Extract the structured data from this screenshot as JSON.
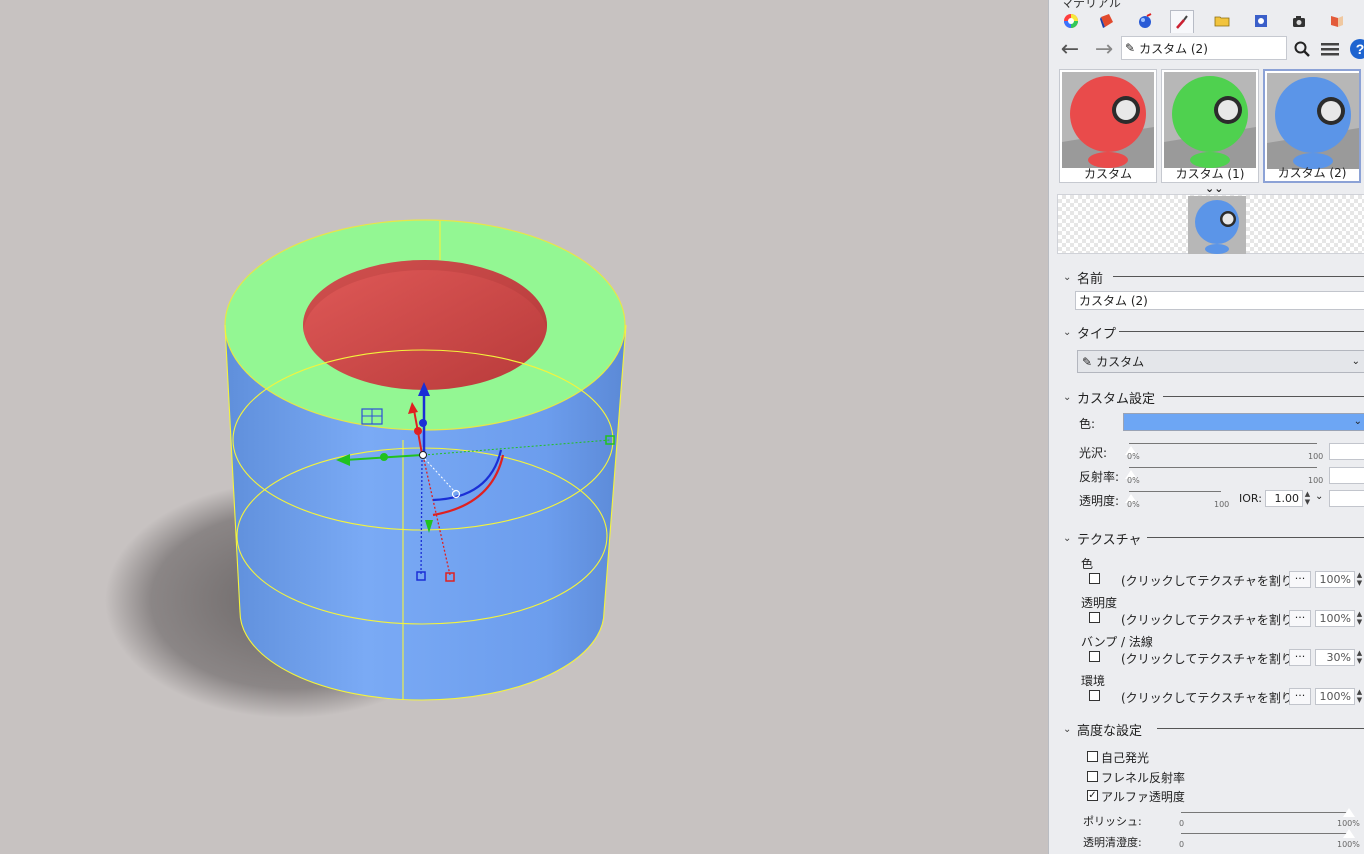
{
  "panel": {
    "title": "マテリアル",
    "tabs": [
      "color-wheel-icon",
      "paint-bucket-icon",
      "sphere-icon",
      "eyedropper-icon",
      "folder-icon",
      "image-icon",
      "camera-icon",
      "material-book-icon"
    ],
    "search": {
      "value": "カスタム (2)"
    },
    "thumbnails": [
      {
        "label": "カスタム",
        "color": "#e94b4b"
      },
      {
        "label": "カスタム (1)",
        "color": "#4fd14f"
      },
      {
        "label": "カスタム (2)",
        "color": "#5b95e8"
      }
    ],
    "expand_glyph": "⌄⌄"
  },
  "sections": {
    "name": {
      "title": "名前",
      "value": "カスタム (2)"
    },
    "type": {
      "title": "タイプ",
      "value": "カスタム"
    },
    "custom": {
      "title": "カスタム設定",
      "color_label": "色:",
      "color_value": "#6da6f4",
      "gloss_label": "光沢:",
      "reflect_label": "反射率:",
      "transparency_label": "透明度:",
      "ior_label": "IOR:",
      "ior_value": "1.00",
      "tick_min": "0%",
      "tick_max": "100"
    },
    "texture": {
      "title": "テクスチャ",
      "rows": [
        {
          "label": "色",
          "text": "(クリックしてテクスチャを割り...",
          "percent": "100%"
        },
        {
          "label": "透明度",
          "text": "(クリックしてテクスチャを割り...",
          "percent": "100%"
        },
        {
          "label": "バンプ / 法線",
          "text": "(クリックしてテクスチャを割り...",
          "percent": "30%"
        },
        {
          "label": "環境",
          "text": "(クリックしてテクスチャを割り...",
          "percent": "100%"
        }
      ],
      "dots": "···"
    },
    "advanced": {
      "title": "高度な設定",
      "options": [
        {
          "label": "自己発光",
          "checked": false
        },
        {
          "label": "フレネル反射率",
          "checked": false
        },
        {
          "label": "アルファ透明度",
          "checked": true
        }
      ],
      "polish_label": "ポリッシュ:",
      "clarity_label": "透明清澄度:",
      "tick_min": "0",
      "tick_max": "100%"
    }
  },
  "colors": {
    "viewport_bg": "#c7c2c1",
    "cylinder_side": "#6fa0ee",
    "top_ring": "#93f793",
    "inner_hole": "#d9504e",
    "edge_highlight": "#f4f43c"
  }
}
